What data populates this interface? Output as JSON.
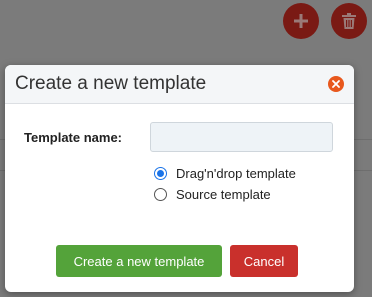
{
  "background": {
    "add_button_icon": "plus-icon",
    "delete_button_icon": "trash-icon"
  },
  "modal": {
    "title": "Create a new template",
    "close_icon": "close-icon",
    "form": {
      "name_label": "Template name:",
      "name_value": "",
      "name_placeholder": "",
      "template_types": [
        {
          "label": "Drag'n'drop template",
          "checked": true
        },
        {
          "label": "Source template",
          "checked": false
        }
      ]
    },
    "buttons": {
      "create_label": "Create a new template",
      "cancel_label": "Cancel"
    }
  },
  "colors": {
    "primary": "#54a33a",
    "cancel": "#c9302c",
    "close": "#e8581d",
    "radio_selected": "#1a73e8"
  }
}
